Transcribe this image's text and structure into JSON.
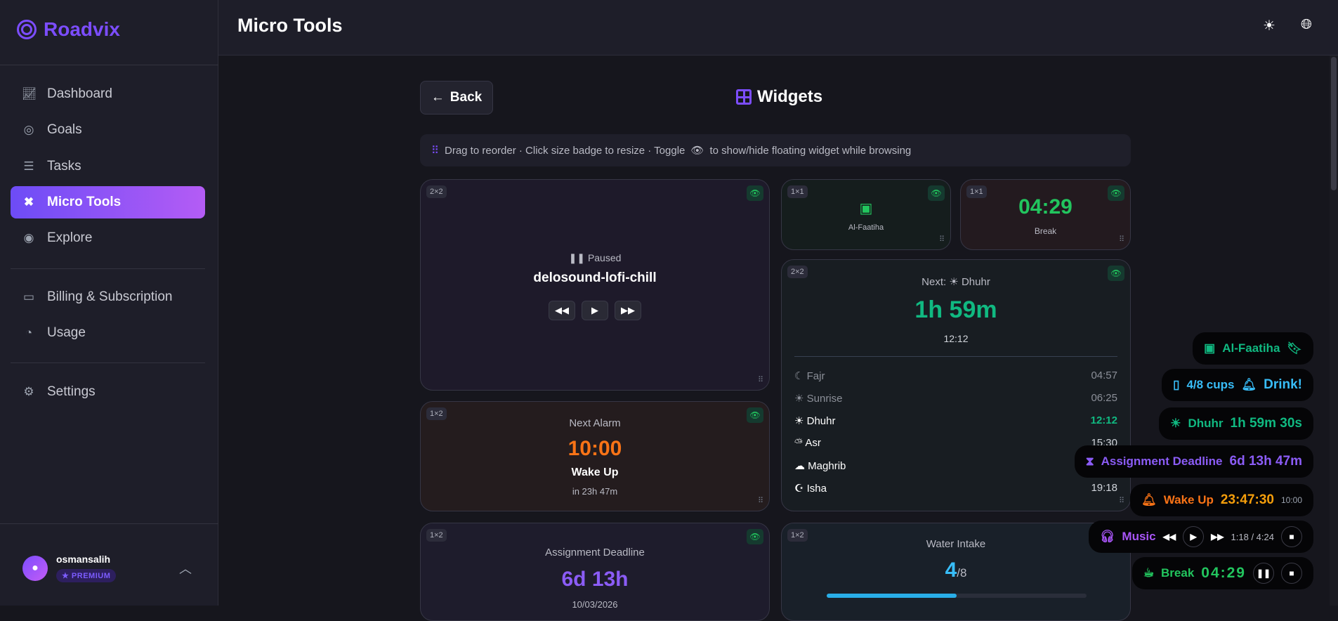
{
  "brand": "Roadvix",
  "sidebar": {
    "items": [
      {
        "label": "Dashboard",
        "icon": "chart-line-icon"
      },
      {
        "label": "Goals",
        "icon": "target-icon"
      },
      {
        "label": "Tasks",
        "icon": "list-check-icon"
      },
      {
        "label": "Micro Tools",
        "icon": "tools-icon"
      },
      {
        "label": "Explore",
        "icon": "compass-icon"
      },
      {
        "label": "Billing & Subscription",
        "icon": "credit-card-icon"
      },
      {
        "label": "Usage",
        "icon": "pie-chart-icon"
      },
      {
        "label": "Settings",
        "icon": "gear-icon"
      }
    ],
    "user": {
      "name": "osmansalih",
      "plan": "PREMIUM"
    }
  },
  "header": {
    "title": "Micro Tools"
  },
  "page": {
    "back": "Back",
    "title": "Widgets",
    "info_a": "Drag to reorder · Click size badge to resize · Toggle",
    "info_b": "to show/hide floating widget while browsing"
  },
  "widgets": {
    "music": {
      "size": "2×2",
      "status": "Paused",
      "track": "delosound-lofi-chill"
    },
    "quran": {
      "size": "1×1",
      "name": "Al-Faatiha"
    },
    "break": {
      "size": "1×1",
      "time": "04:29",
      "label": "Break"
    },
    "prayer": {
      "size": "2×2",
      "next_label": "Next:",
      "next_name": "Dhuhr",
      "countdown": "1h 59m",
      "next_time": "12:12",
      "times": [
        {
          "name": "Fajr",
          "time": "04:57",
          "icon": "moon-icon"
        },
        {
          "name": "Sunrise",
          "time": "06:25",
          "icon": "sun-icon"
        },
        {
          "name": "Dhuhr",
          "time": "12:12",
          "icon": "sun-icon"
        },
        {
          "name": "Asr",
          "time": "15:30",
          "icon": "cloud-sun-icon"
        },
        {
          "name": "Maghrib",
          "time": "",
          "icon": "cloud-moon-icon"
        },
        {
          "name": "Isha",
          "time": "19:18",
          "icon": "star-crescent-icon"
        }
      ]
    },
    "alarm": {
      "size": "1×2",
      "title": "Next Alarm",
      "time": "10:00",
      "label": "Wake Up",
      "remaining": "in 23h 47m"
    },
    "deadline": {
      "size": "1×2",
      "title": "Assignment Deadline",
      "remaining": "6d 13h",
      "date": "10/03/2026"
    },
    "water": {
      "size": "1×2",
      "title": "Water Intake",
      "count": "4",
      "total": "/8",
      "progress": 0.5
    }
  },
  "floating": {
    "quran": "Al-Faatiha",
    "water": {
      "cups": "4/8 cups",
      "alert": "Drink!"
    },
    "prayer": {
      "name": "Dhuhr",
      "countdown": "1h 59m 30s"
    },
    "deadline": {
      "name": "Assignment Deadline",
      "countdown": "6d 13h 47m"
    },
    "alarm": {
      "name": "Wake Up",
      "countdown": "23:47:30",
      "time": "10:00"
    },
    "music": {
      "label": "Music",
      "position": "1:18 / 4:24"
    },
    "break": {
      "label": "Break",
      "time": "04:29"
    }
  },
  "colors": {
    "accent": "#7c4dff",
    "green": "#22c55e",
    "orange": "#f97316",
    "blue": "#38bdf8"
  }
}
